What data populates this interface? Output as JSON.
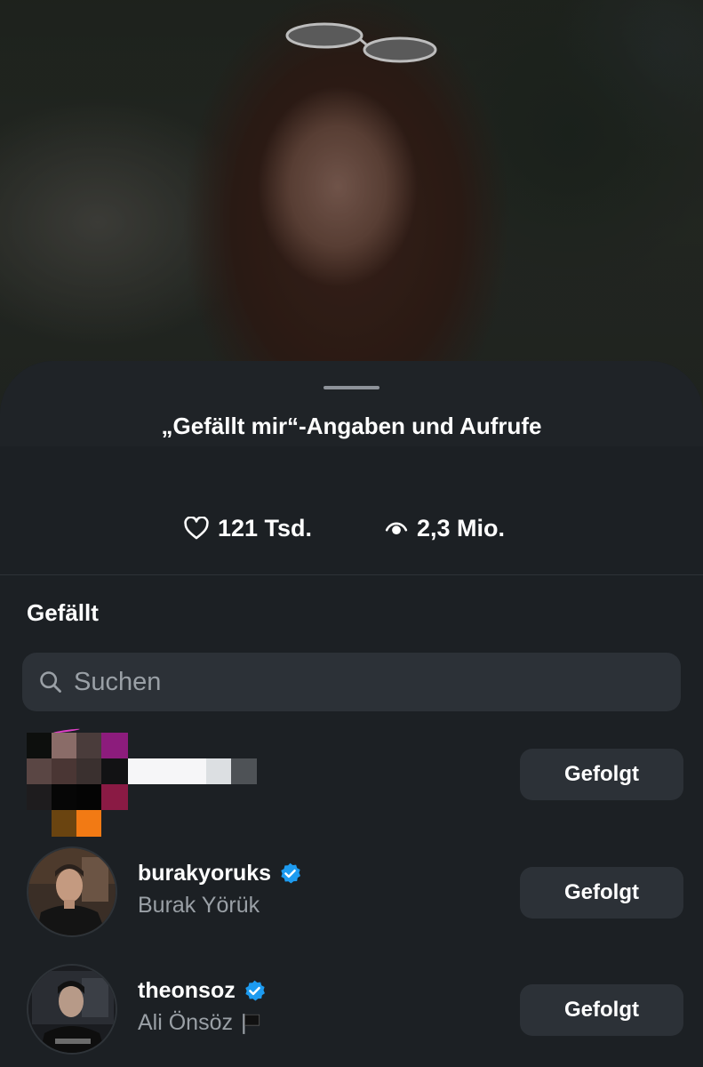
{
  "sheet": {
    "title": "„Gefällt mir“-Angaben und Aufrufe"
  },
  "stats": {
    "likes": {
      "icon": "heart-outline-icon",
      "value": "121 Tsd."
    },
    "views": {
      "icon": "eye-icon",
      "value": "2,3 Mio."
    }
  },
  "likes_section": {
    "title": "Gefällt",
    "search": {
      "placeholder": "Suchen",
      "value": ""
    }
  },
  "users": [
    {
      "username": "",
      "fullname": "",
      "verified": false,
      "button": "Gefolgt",
      "censored": true
    },
    {
      "username": "burakyoruks",
      "fullname": "Burak Yörük",
      "verified": true,
      "button": "Gefolgt"
    },
    {
      "username": "theonsoz",
      "fullname": "Ali Önsöz",
      "verified": true,
      "flag": "black-flag-icon",
      "button": "Gefolgt"
    }
  ],
  "colors": {
    "background": "#1c2024",
    "button": "#2c3137",
    "verified": "#1d9bf0",
    "secondary_text": "#9aa0a6"
  }
}
